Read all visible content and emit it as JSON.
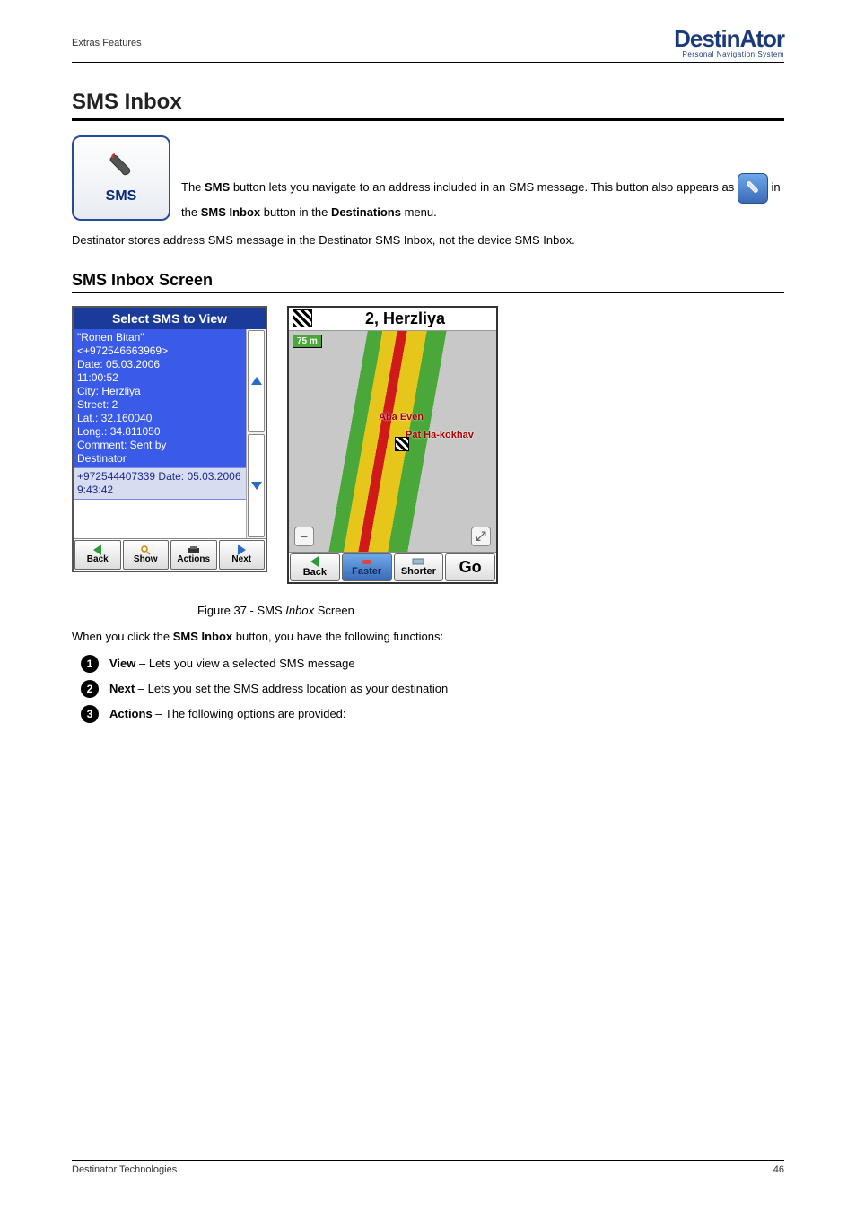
{
  "header": {
    "left": "Extras Features",
    "logo_main": "DestinAtor",
    "logo_sub": "Personal Navigation System"
  },
  "section": {
    "title": "SMS Inbox"
  },
  "sms_button": {
    "label": "SMS"
  },
  "para1_prefix": "The ",
  "para1_bold": "SMS",
  "para1_mid": " button lets you navigate to an address included in an SMS message. This button also appears as ",
  "para1_after_icon": " in the ",
  "para1_bold2": "SMS Inbox",
  "para1_suffix": " button in the ",
  "para1_bold3": "Destinations",
  "para1_end": " menu.",
  "para2": "Destinator stores address SMS message in the Destinator SMS Inbox, not the device SMS Inbox.",
  "subhead": "SMS Inbox Screen",
  "sms_screen": {
    "title": "Select SMS to View",
    "msg1": {
      "name": "\"Ronen Bitan\"",
      "num": "<+972546663969>",
      "date": "Date: 05.03.2006",
      "time": "11:00:52",
      "city": "City: Herzliya",
      "street": "Street: 2",
      "lat": "Lat.: 32.160040",
      "long": "Long.: 34.811050",
      "comment": "Comment: Sent by",
      "app": "Destinator"
    },
    "msg2": "+972544407339 Date: 05.03.2006 9:43:42",
    "buttons": {
      "back": "Back",
      "show": "Show",
      "actions": "Actions",
      "next": "Next"
    }
  },
  "map_screen": {
    "title": "2, Herzliya",
    "scale": "75 m",
    "road1": "Aba Even",
    "road2": "Pat Ha-kokhav",
    "buttons": {
      "back": "Back",
      "faster": "Faster",
      "shorter": "Shorter",
      "go": "Go"
    }
  },
  "figure_caption_prefix": "Figure 37 - SMS ",
  "figure_caption_em": "Inbox",
  "figure_caption_suffix": " Screen",
  "bullet_intro_prefix": "When you click the ",
  "bullet_intro_bold": "SMS Inbox",
  "bullet_intro_suffix": " button, you have the following functions:",
  "bullets": [
    {
      "num": "1",
      "lead": "View",
      "text": " – Lets you view a selected SMS message"
    },
    {
      "num": "2",
      "lead": "Next",
      "text": " – Lets you set the SMS address location as your destination"
    },
    {
      "num": "3",
      "lead": "Actions",
      "text": " – The following options are provided:"
    }
  ],
  "footer": {
    "left": "Destinator Technologies",
    "right": "46"
  }
}
